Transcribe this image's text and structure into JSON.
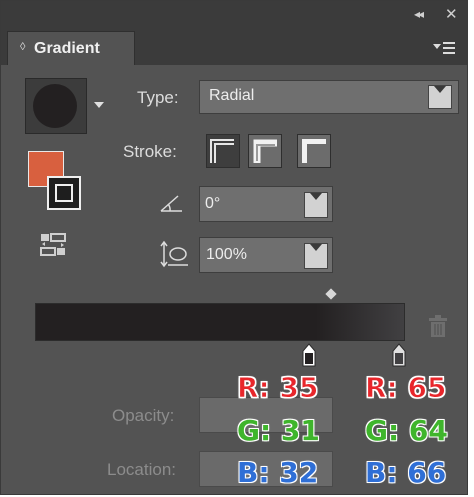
{
  "window": {
    "collapse_icon": "double-chevron-left-icon",
    "close_icon": "close-icon",
    "tab_title": "Gradient",
    "tab_arrows": "⌃⌄",
    "menu_icon": "panel-menu-icon"
  },
  "gradient": {
    "type_label": "Type:",
    "type_value": "Radial",
    "stroke_label": "Stroke:",
    "angle_value": "0°",
    "aspect_value": "100%",
    "opacity_label": "Opacity:",
    "location_label": "Location:"
  },
  "stops": [
    {
      "r": "R: 35",
      "g": "G: 31",
      "b": "B: 32"
    },
    {
      "r": "R: 65",
      "g": "G: 64",
      "b": "B: 66"
    }
  ],
  "colors": {
    "panel_bg": "#535353",
    "fill": "#d8603f",
    "gradient_start": "#232021",
    "gradient_end": "#414042",
    "annot_red": "#e8262b",
    "annot_green": "#3fb52c",
    "annot_blue": "#2f6fd6"
  }
}
